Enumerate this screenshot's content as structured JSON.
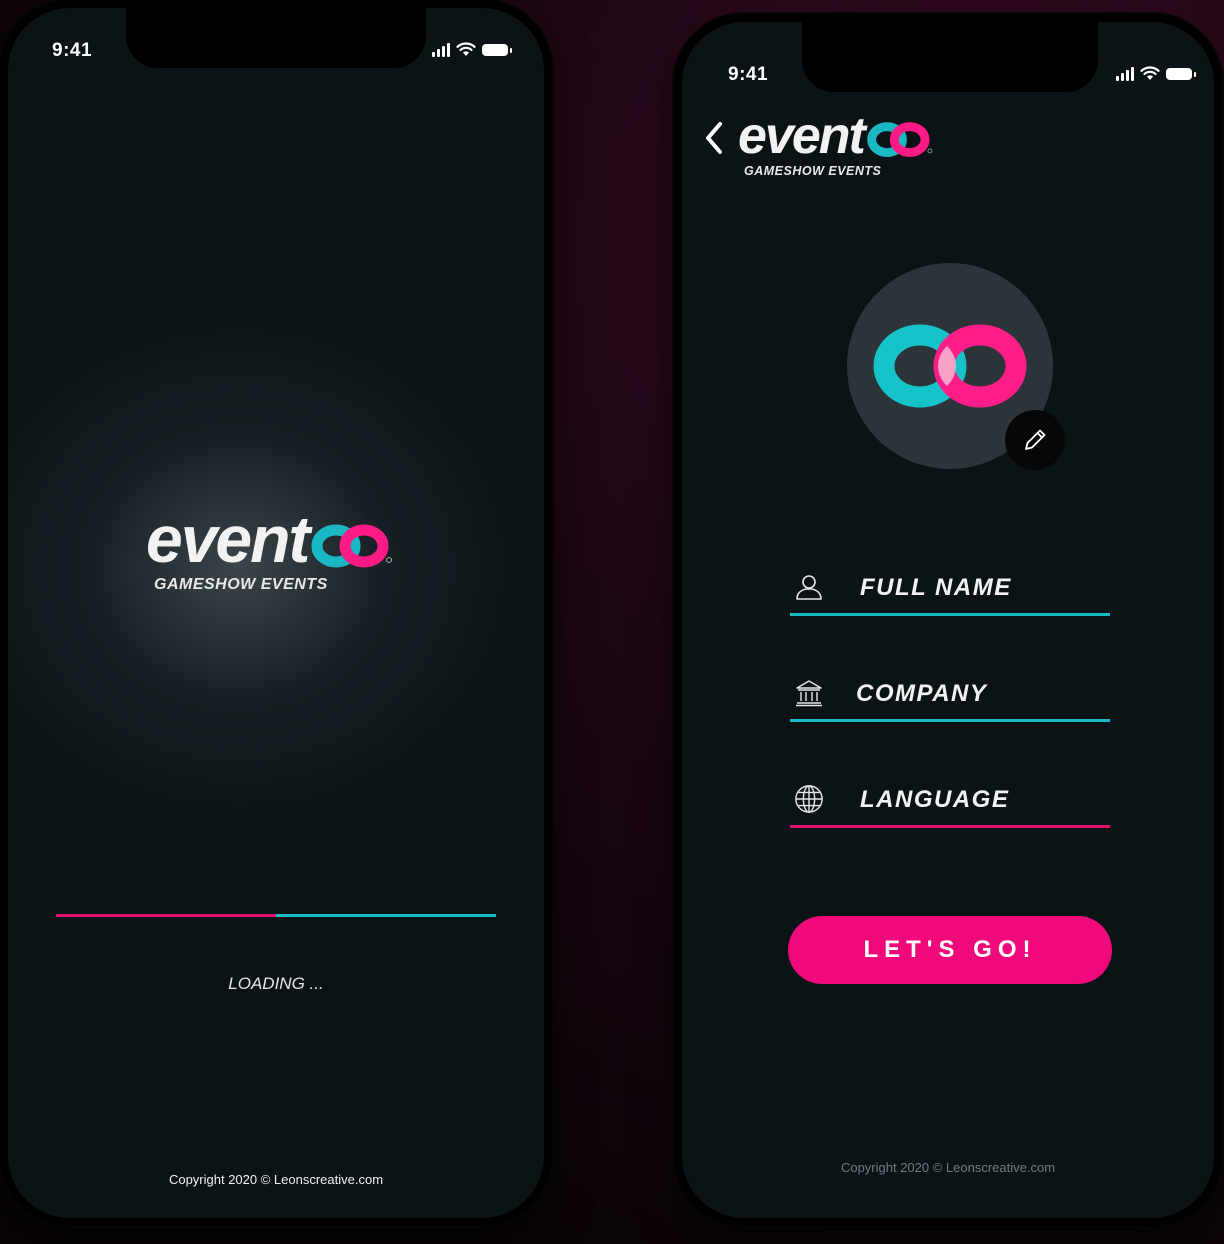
{
  "colors": {
    "accent_pink": "#e0106e",
    "accent_teal": "#1ab8c4",
    "button_pink": "#f0097a",
    "screen_bg": "#0b1317"
  },
  "brand": {
    "name_prefix": "event",
    "name_suffix": "oo",
    "tagline": "GAMESHOW EVENTS"
  },
  "splash_screen": {
    "status_time": "9:41",
    "loading_label": "LOADING ...",
    "loading_progress": 0.5,
    "copyright": "Copyright 2020 © Leonscreative.com"
  },
  "profile_screen": {
    "status_time": "9:41",
    "back_icon": "chevron-left-icon",
    "edit_icon": "pencil-icon",
    "fields": [
      {
        "label": "FULL NAME",
        "icon": "user-icon",
        "underline_color": "#1ab8c4"
      },
      {
        "label": "COMPANY",
        "icon": "bank-icon",
        "underline_color": "#1ab8c4"
      },
      {
        "label": "LANGUAGE",
        "icon": "globe-icon",
        "underline_color": "#e0106e"
      }
    ],
    "submit_label": "LET'S GO!",
    "copyright": "Copyright 2020 © Leonscreative.com"
  }
}
